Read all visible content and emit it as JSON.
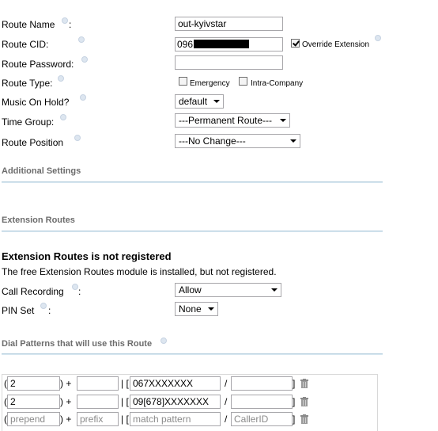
{
  "route": {
    "name_label": "Route Name",
    "name_colon": ":",
    "name_value": "out-kyivstar",
    "cid_label": "Route CID:",
    "cid_value": "096",
    "override_label": "Override Extension",
    "password_label": "Route Password:",
    "password_value": "",
    "type_label": "Route Type:",
    "emergency_label": "Emergency",
    "intra_label": "Intra-Company",
    "moh_label": "Music On Hold?",
    "moh_value": "default",
    "time_group_label": "Time Group:",
    "time_group_value": "---Permanent Route---",
    "position_label": "Route Position",
    "position_value": "---No Change---"
  },
  "sections": {
    "additional": "Additional Settings",
    "extension_routes": "Extension Routes",
    "dial_patterns": "Dial Patterns that will use this Route"
  },
  "ext_routes": {
    "heading": "Extension Routes is not registered",
    "notice": "The free Extension Routes module is installed, but not registered.",
    "call_recording_label": "Call Recording",
    "call_recording_colon": ":",
    "call_recording_value": "Allow",
    "pin_set_label": "PIN Set",
    "pin_set_colon": ":",
    "pin_set_value": "None"
  },
  "dial_patterns": {
    "rows": [
      {
        "prepend": "2",
        "prefix": "",
        "match": "067XXXXXXX",
        "callerid": ""
      },
      {
        "prepend": "2",
        "prefix": "",
        "match": "09[678]XXXXXXX",
        "callerid": ""
      }
    ],
    "placeholders": {
      "prepend": "prepend",
      "prefix": "prefix",
      "match": "match pattern",
      "callerid": "CallerID"
    },
    "symbols": {
      "open_paren": "(",
      "close_paren_plus": ") +",
      "bar_bracket": "| [",
      "slash": "/",
      "close_bracket": "]"
    }
  },
  "icons": {
    "help": "help-icon",
    "trash": "trash-icon"
  },
  "colors": {
    "section_text": "#6c6c6c",
    "rule": "#b8d0df",
    "help_dot": "#dde6f0"
  }
}
